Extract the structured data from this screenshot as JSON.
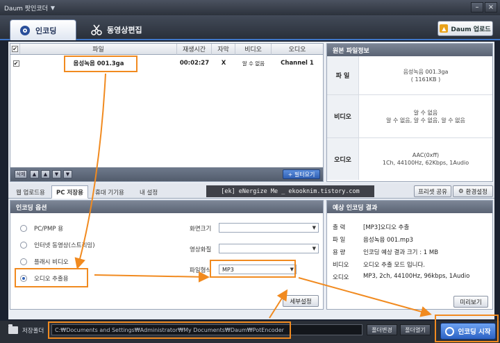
{
  "window": {
    "title": "Daum 팟인코더"
  },
  "main_tabs": [
    {
      "label": "인코딩"
    },
    {
      "label": "동영상편집"
    }
  ],
  "upload_button": "Daum 업로드",
  "file_table": {
    "headers": [
      "파일",
      "재생시간",
      "자막",
      "비디오",
      "오디오"
    ],
    "rows": [
      {
        "checked": "✔",
        "file": "음성녹음 001.3ga",
        "duration": "00:02:27",
        "subtitle": "X",
        "video": "알 수 없음",
        "audio": "Channel 1"
      }
    ],
    "footer_first_button": "삭제",
    "filter_button": "+ 필터요기"
  },
  "original_info": {
    "title": "원본 파일정보",
    "rows": [
      {
        "label": "파 일",
        "lines": [
          "음성녹음 001.3ga",
          "( 1161KB )"
        ]
      },
      {
        "label": "비디오",
        "lines": [
          "알 수 없음",
          "알 수 없음, 알 수 없음, 알 수 없음"
        ]
      },
      {
        "label": "오디오",
        "lines": [
          "AAC(0xff)",
          "1Ch, 44100Hz, 62Kbps, 1Audio"
        ]
      }
    ]
  },
  "sub_tabs": [
    {
      "label": "웹 업로드용"
    },
    {
      "label": "PC 저장용"
    },
    {
      "label": "휴대 기기용"
    },
    {
      "label": "내 설정"
    }
  ],
  "watermark": "[ek] eNergize Me _ ekooknim.tistory.com",
  "preset_share": "프리셋 공유",
  "env_settings": "환경설정",
  "options": {
    "title": "인코딩 옵션",
    "radios": [
      "PC/PMP 용",
      "인터넷 동영상(스트리밍)",
      "플래시 비디오",
      "오디오 추출용"
    ],
    "selected_index": 3,
    "fields": [
      {
        "label": "화면크기",
        "value": ""
      },
      {
        "label": "영상화질",
        "value": ""
      },
      {
        "label": "파일형식",
        "value": "MP3"
      }
    ],
    "detail_button": "세부설정"
  },
  "result": {
    "title": "예상 인코딩 결과",
    "rows": [
      {
        "label": "출 력",
        "value": "[MP3]오디오 추출"
      },
      {
        "label": "파 일",
        "value": "음성녹음 001.mp3"
      },
      {
        "label": "용 량",
        "value": "인코딩 예상 결과 크기 : 1 MB"
      },
      {
        "label": "비디오",
        "value": "오디오 추출 모드 입니다."
      },
      {
        "label": "오디오",
        "value": "MP3, 2ch, 44100Hz, 96kbps, 1Audio"
      }
    ],
    "preview_button": "미리보기"
  },
  "status_bar": {
    "label": "저장폴더",
    "path": "C:₩Documents and Settings₩Administrator₩My Documents₩Daum₩PotEncoder",
    "open_folder": "폴더열기",
    "change_folder": "폴더변경"
  },
  "start_button": "인코딩 시작",
  "colors": {
    "accent": "#3f77c8",
    "highlight": "#f18a1f"
  }
}
